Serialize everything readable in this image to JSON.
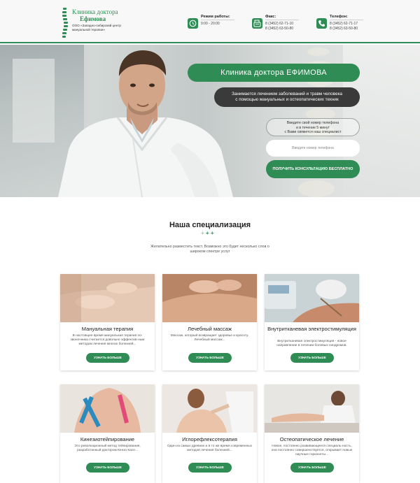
{
  "header": {
    "logo": {
      "name_line1": "Клиника доктора",
      "name_line2": "Ефимова",
      "subtitle": "ООО «Западно-сибирский центр мануальной терапии»"
    },
    "schedule": {
      "label": "Режим работы:",
      "value": "9:00 - 20:00",
      "icon": "clock-icon"
    },
    "fax": {
      "label": "Факс:",
      "line1": "8 (3452) 62-71-10",
      "line2": "8 (3452) 63-50-80",
      "icon": "fax-icon"
    },
    "phone": {
      "label": "Телефон:",
      "line1": "8 (3452) 62-71-17",
      "line2": "8 (3452) 63-50-80",
      "icon": "phone-icon"
    }
  },
  "hero": {
    "title": "Клиника доктора ЕФИМОВА",
    "description_line1": "Занимается лечением заболеваний и травм человека",
    "description_line2": "с помощью мануальных и остеопатических техник",
    "cta_line1": "Введите свой номер телефона",
    "cta_line2": "и в течение 5 минут",
    "cta_line3": "с Вами свяжется наш специалист",
    "phone_placeholder": "Введите номер телефона",
    "button": "ПОЛУЧИТЬ КОНСУЛЬТАЦИЮ БЕСПЛАТНО"
  },
  "specialization": {
    "title": "Наша специализация",
    "subtitle_line1": "Желательно разместить текст. Возможно это будет несколько слов о",
    "subtitle_line2": "широком спектре услуг",
    "cards": [
      {
        "title": "Мануальная терапия",
        "text": "В настоящее время мануальная терапия по-звоночника считается довольно эффектив-ным методом лечения многих болезней...",
        "button": "УЗНАТЬ БОЛЬШЕ"
      },
      {
        "title": "Лечебный массаж",
        "text": "Массаж, который возвращает здоровье и красоту. Лечебный массаж...",
        "button": "УЗНАТЬ БОЛЬШЕ"
      },
      {
        "title": "Внутритканевая электростимуляция",
        "text": "Внутритканевая электростимуляция - новое направление в лечении болевых синдромов.",
        "button": "УЗНАТЬ БОЛЬШЕ"
      },
      {
        "title": "Кинезиотейпирование",
        "text": "Это революционный метод тейпирования, разработанный доктором Кензо Касе...",
        "button": "УЗНАТЬ БОЛЬШЕ"
      },
      {
        "title": "Иглорефлексотерапия",
        "text": "Один из самых древних и в то же время современных методов лечения болезней...",
        "button": "УЗНАТЬ БОЛЬШЕ"
      },
      {
        "title": "Остеопатическое лечение",
        "text": "Новое, постоянно развивающееся специаль-ность, она постоянно совершенствуется, открывает новые научные горизонты...",
        "button": "УЗНАТЬ БОЛЬШЕ"
      }
    ]
  }
}
